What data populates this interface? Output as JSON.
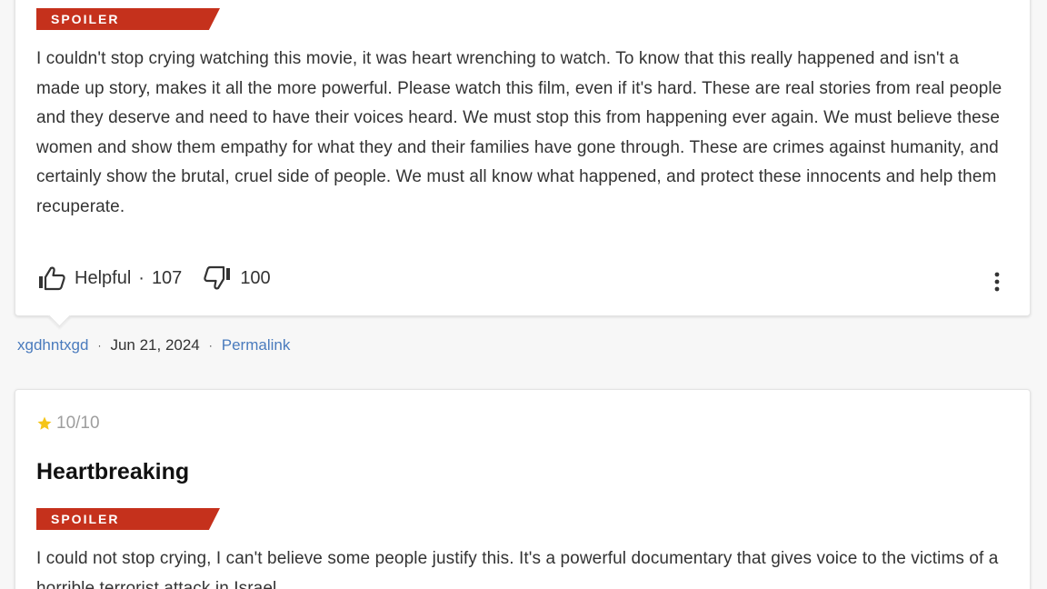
{
  "review1": {
    "spoiler_label": "SPOILER",
    "text": "I couldn't stop crying watching this movie, it was heart wrenching to watch. To know that this really happened and isn't a made up story, makes it all the more powerful. Please watch this film, even if it's hard. These are real stories from real people and they deserve and need to have their voices heard. We must stop this from happening ever again. We must believe these women and show them empathy for what they and their families have gone through. These are crimes against humanity, and certainly show the brutal, cruel side of people. We must all know what happened, and protect these innocents and help them recuperate.",
    "helpful_label": "Helpful",
    "helpful_separator": "·",
    "helpful_count": "107",
    "not_helpful_count": "100",
    "icons": {
      "thumb_up": "thumb-up-icon",
      "thumb_down": "thumb-down-icon",
      "more": "more-vertical-icon"
    },
    "meta": {
      "author": "xgdhntxgd",
      "separator": "·",
      "date": "Jun 21, 2024",
      "permalink_label": "Permalink"
    }
  },
  "review2": {
    "rating": "10/10",
    "title": "Heartbreaking",
    "spoiler_label": "SPOILER",
    "text": "I could not stop crying, I can't believe some people justify this. It's a powerful documentary that gives voice to the victims of a horrible terrorist attack in Israel."
  },
  "colors": {
    "spoiler_bg": "#c5311c",
    "link": "#4a7bbd",
    "star": "#f5c518",
    "rating_text": "#9e9e9e"
  }
}
